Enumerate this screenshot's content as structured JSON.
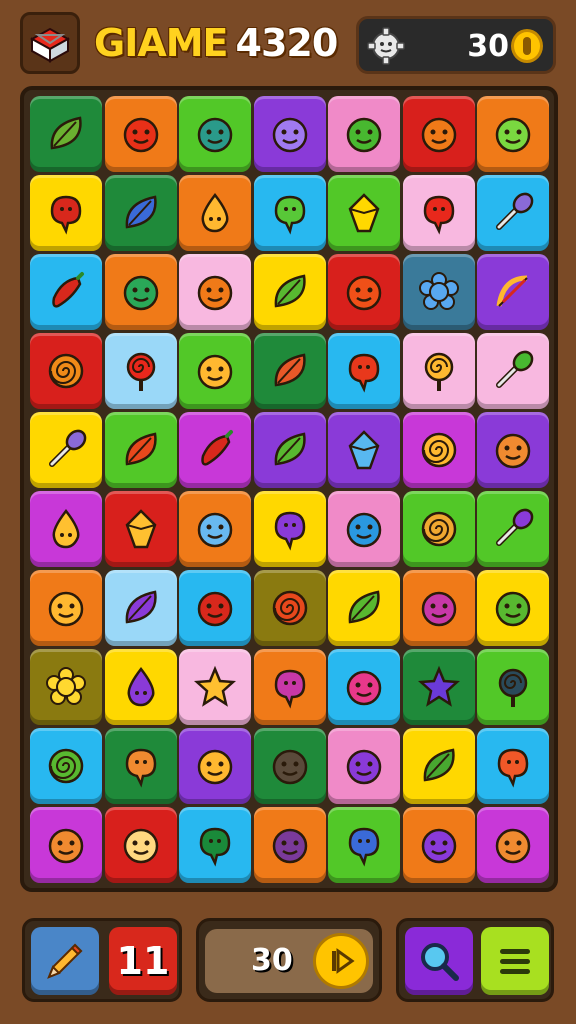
{
  "header": {
    "title": "GIAME",
    "score": "4320",
    "coins": "30",
    "logo_icon": "gift-box-icon",
    "settings_icon": "gear-icon",
    "coin_icon": "coin-icon"
  },
  "footer": {
    "pencil_icon": "pencil-icon",
    "moves": "11",
    "counter": "30",
    "play_icon": "play-icon",
    "search_icon": "search-icon",
    "menu_icon": "menu-icon"
  },
  "colors": {
    "green": "#1f8a3a",
    "orange": "#f07a18",
    "lime": "#52c828",
    "purple": "#8a3ad8",
    "pink": "#f08ac8",
    "red": "#d8201c",
    "yellow": "#ffd800",
    "sky": "#28b8f0",
    "lightpink": "#f8b8e0",
    "slate": "#3a7a9a",
    "magenta": "#c838d8",
    "lightblue": "#9ad8f8",
    "olive": "#8a7a10",
    "mint": "#1aa868"
  },
  "board": {
    "rows": [
      [
        {
          "bg": "green",
          "icon": "leaf",
          "fg": "#6ab030"
        },
        {
          "bg": "orange",
          "icon": "face",
          "fg": "#e83018"
        },
        {
          "bg": "lime",
          "icon": "face",
          "fg": "#2a9a8a"
        },
        {
          "bg": "purple",
          "icon": "face",
          "fg": "#a07af0"
        },
        {
          "bg": "pink",
          "icon": "face",
          "fg": "#48b830"
        },
        {
          "bg": "red",
          "icon": "face",
          "fg": "#f07a18"
        },
        {
          "bg": "orange",
          "icon": "face",
          "fg": "#7ad840"
        }
      ],
      [
        {
          "bg": "yellow",
          "icon": "blob",
          "fg": "#d8281c"
        },
        {
          "bg": "green",
          "icon": "leaf",
          "fg": "#3a6ad8"
        },
        {
          "bg": "orange",
          "icon": "drop",
          "fg": "#ffb830"
        },
        {
          "bg": "sky",
          "icon": "blob",
          "fg": "#58c838"
        },
        {
          "bg": "lime",
          "icon": "gem",
          "fg": "#ffd800"
        },
        {
          "bg": "lightpink",
          "icon": "blob",
          "fg": "#e8281c"
        },
        {
          "bg": "sky",
          "icon": "wand",
          "fg": "#8a6ad8"
        }
      ],
      [
        {
          "bg": "sky",
          "icon": "pepper",
          "fg": "#d8281c"
        },
        {
          "bg": "orange",
          "icon": "face",
          "fg": "#2aa858"
        },
        {
          "bg": "lightpink",
          "icon": "face",
          "fg": "#f07a18"
        },
        {
          "bg": "yellow",
          "icon": "leaf",
          "fg": "#58b830"
        },
        {
          "bg": "red",
          "icon": "face",
          "fg": "#f05018"
        },
        {
          "bg": "slate",
          "icon": "flower",
          "fg": "#58a8f0"
        },
        {
          "bg": "purple",
          "icon": "bow",
          "fg": "#ffb830"
        }
      ],
      [
        {
          "bg": "red",
          "icon": "spiral",
          "fg": "#f08a18"
        },
        {
          "bg": "lightblue",
          "icon": "lollipop",
          "fg": "#e8281c"
        },
        {
          "bg": "lime",
          "icon": "face",
          "fg": "#ffb830"
        },
        {
          "bg": "green",
          "icon": "leaf",
          "fg": "#e85828"
        },
        {
          "bg": "sky",
          "icon": "blob",
          "fg": "#e8381c"
        },
        {
          "bg": "lightpink",
          "icon": "lollipop",
          "fg": "#ffb830"
        },
        {
          "bg": "lightpink",
          "icon": "wand",
          "fg": "#48b830"
        }
      ],
      [
        {
          "bg": "yellow",
          "icon": "wand",
          "fg": "#8a6ad8"
        },
        {
          "bg": "lime",
          "icon": "leaf",
          "fg": "#e8481c"
        },
        {
          "bg": "magenta",
          "icon": "pepper",
          "fg": "#d8281c"
        },
        {
          "bg": "purple",
          "icon": "leaf",
          "fg": "#58b830"
        },
        {
          "bg": "purple",
          "icon": "gem",
          "fg": "#58b8f0"
        },
        {
          "bg": "magenta",
          "icon": "spiral",
          "fg": "#ffb830"
        },
        {
          "bg": "purple",
          "icon": "face",
          "fg": "#f08a30"
        }
      ],
      [
        {
          "bg": "magenta",
          "icon": "drop",
          "fg": "#ffc030"
        },
        {
          "bg": "red",
          "icon": "gem",
          "fg": "#ffc030"
        },
        {
          "bg": "orange",
          "icon": "face",
          "fg": "#68b8f0"
        },
        {
          "bg": "yellow",
          "icon": "blob",
          "fg": "#8a3ad8"
        },
        {
          "bg": "pink",
          "icon": "face",
          "fg": "#2a98e0"
        },
        {
          "bg": "lime",
          "icon": "spiral",
          "fg": "#f0a830"
        },
        {
          "bg": "lime",
          "icon": "wand",
          "fg": "#8a3ad8"
        }
      ],
      [
        {
          "bg": "orange",
          "icon": "face",
          "fg": "#ffb830"
        },
        {
          "bg": "lightblue",
          "icon": "leaf",
          "fg": "#8a3ad8"
        },
        {
          "bg": "sky",
          "icon": "face",
          "fg": "#d8281c"
        },
        {
          "bg": "olive",
          "icon": "spiral",
          "fg": "#e8481c"
        },
        {
          "bg": "yellow",
          "icon": "leaf",
          "fg": "#58b830"
        },
        {
          "bg": "orange",
          "icon": "face",
          "fg": "#c838a8"
        },
        {
          "bg": "yellow",
          "icon": "face",
          "fg": "#58b830"
        }
      ],
      [
        {
          "bg": "olive",
          "icon": "flower",
          "fg": "#ffd830"
        },
        {
          "bg": "yellow",
          "icon": "drop",
          "fg": "#8a3ad8"
        },
        {
          "bg": "lightpink",
          "icon": "star",
          "fg": "#ffc030"
        },
        {
          "bg": "orange",
          "icon": "blob",
          "fg": "#c838a8"
        },
        {
          "bg": "sky",
          "icon": "face",
          "fg": "#e8388a"
        },
        {
          "bg": "green",
          "icon": "star",
          "fg": "#6a3ad8"
        },
        {
          "bg": "lime",
          "icon": "lollipop",
          "fg": "#2a4a5a"
        }
      ],
      [
        {
          "bg": "sky",
          "icon": "spiral",
          "fg": "#58b830"
        },
        {
          "bg": "green",
          "icon": "blob",
          "fg": "#f08a30"
        },
        {
          "bg": "purple",
          "icon": "face",
          "fg": "#ffb830"
        },
        {
          "bg": "green",
          "icon": "face",
          "fg": "#5a4a3a"
        },
        {
          "bg": "pink",
          "icon": "face",
          "fg": "#8a3ad8"
        },
        {
          "bg": "yellow",
          "icon": "leaf",
          "fg": "#48a830"
        },
        {
          "bg": "sky",
          "icon": "blob",
          "fg": "#f05828"
        }
      ],
      [
        {
          "bg": "magenta",
          "icon": "face",
          "fg": "#f08a30"
        },
        {
          "bg": "red",
          "icon": "face",
          "fg": "#ffd880"
        },
        {
          "bg": "sky",
          "icon": "blob",
          "fg": "#1a8a3a"
        },
        {
          "bg": "orange",
          "icon": "face",
          "fg": "#7a3a9a"
        },
        {
          "bg": "lime",
          "icon": "blob",
          "fg": "#3a6ad8"
        },
        {
          "bg": "orange",
          "icon": "face",
          "fg": "#8a3ad8"
        },
        {
          "bg": "magenta",
          "icon": "face",
          "fg": "#f08a30"
        }
      ]
    ]
  }
}
